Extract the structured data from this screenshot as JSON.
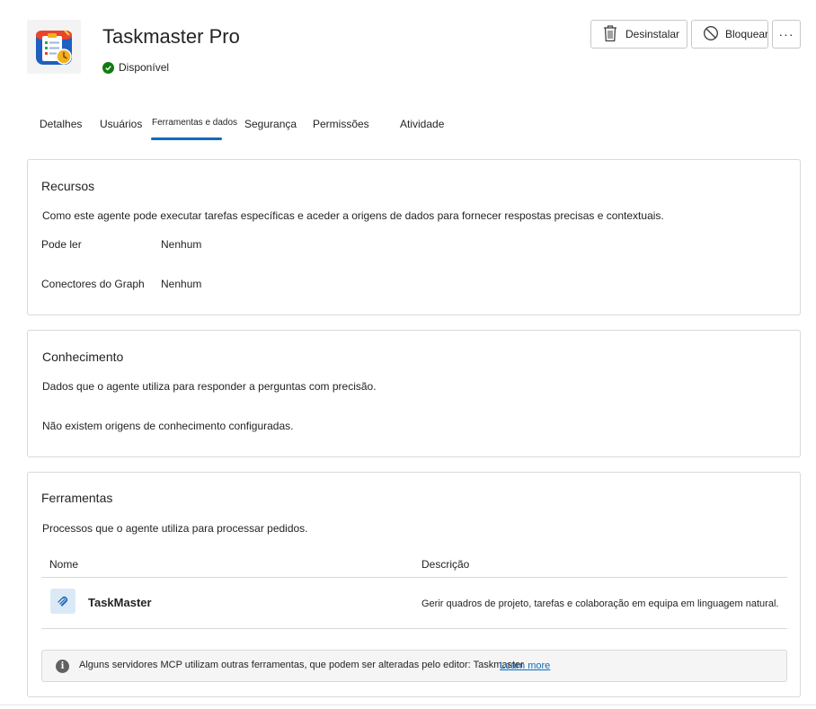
{
  "app": {
    "title": "Taskmaster Pro",
    "status": "Disponível",
    "status_color": "#107c10"
  },
  "actions": {
    "uninstall_label": "Desinstalar",
    "block_label": "Bloquear",
    "more_label": "···"
  },
  "tabs": [
    {
      "label": "Detalhes"
    },
    {
      "label": "Usuários"
    },
    {
      "label": "Ferramentas e dados",
      "active": true
    },
    {
      "label": "Segurança"
    },
    {
      "label": "Permissões"
    },
    {
      "label": "Atividade"
    }
  ],
  "resources": {
    "title": "Recursos",
    "description": "Como este agente pode executar tarefas específicas e aceder a origens de dados para fornecer respostas precisas e contextuais.",
    "rows": [
      {
        "label": "Pode ler",
        "value": "Nenhum"
      },
      {
        "label": "Conectores do Graph",
        "value": "Nenhum"
      }
    ]
  },
  "knowledge": {
    "title": "Conhecimento",
    "description": "Dados que o agente utiliza para responder a perguntas com precisão.",
    "empty": "Não existem origens de conhecimento configuradas."
  },
  "tools": {
    "title": "Ferramentas",
    "description": "Processos que o agente utiliza para processar pedidos.",
    "columns": [
      "Nome",
      "Descrição"
    ],
    "rows": [
      {
        "name": "TaskMaster",
        "description": "Gerir quadros de projeto, tarefas e colaboração em equipa em linguagem natural.",
        "icon": "link-icon"
      }
    ],
    "notice": {
      "text": "Alguns servidores MCP utilizam outras ferramentas, que podem ser alteradas pelo editor: Taskmaster",
      "link": "Learn more"
    }
  },
  "colors": {
    "accent": "#0f6cbd",
    "border": "#d9d9d9"
  }
}
